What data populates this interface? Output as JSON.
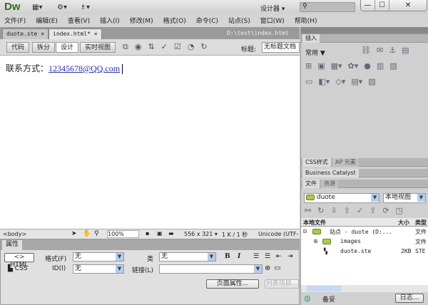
{
  "app": {
    "logo": "Dw",
    "designer": "设计器 ▾",
    "search_placeholder": "",
    "window_buttons": [
      "—",
      "☐",
      "✕"
    ]
  },
  "menu": [
    "文件(F)",
    "编辑(E)",
    "查看(V)",
    "插入(I)",
    "修改(M)",
    "格式(O)",
    "命令(C)",
    "站点(S)",
    "窗口(W)",
    "帮助(H)"
  ],
  "doc_tabs": [
    {
      "label": "duote.ste",
      "close": "×"
    },
    {
      "label": "index.html*",
      "close": "×"
    }
  ],
  "doc_path": "D:\\test\\index.html",
  "toolbar": {
    "views": [
      "代码",
      "拆分",
      "设计",
      "实时视图"
    ],
    "active_view": "设计",
    "title_label": "标题:",
    "title_value": "无标题文档"
  },
  "content": {
    "label": "联系方式：",
    "email": "12345678@QQ.com"
  },
  "status": {
    "tag": "<body>",
    "zoom": "100%",
    "size": "556 x 321 ▾",
    "download": "1 K / 1 秒",
    "encoding": "Unicode (UTF-"
  },
  "properties": {
    "tab": "属性",
    "html_btn": "HTML",
    "css_btn": "CSS",
    "format_label": "格式(F)",
    "format_value": "无",
    "class_label": "类",
    "class_value": "无",
    "id_label": "ID(I)",
    "id_value": "无",
    "link_label": "链接(L)",
    "link_value": "",
    "bold": "B",
    "italic": "I",
    "page_props": "页面属性...",
    "list_item": "列表项目..."
  },
  "right_panel": {
    "insert_tab": "插入",
    "category": "常用",
    "css_tab": "CSS样式",
    "ap_tab": "AP 元素",
    "bc_tab": "Business Catalyst",
    "files_tab": "文件",
    "assets_tab": "资源",
    "site_select": "duote",
    "view_select": "本地视图",
    "columns": [
      "本地文件",
      "大小",
      "类型"
    ],
    "files": [
      {
        "name": "站点 - duote (D:...",
        "size": "",
        "type": "文件"
      },
      {
        "name": "images",
        "size": "",
        "type": "文件"
      },
      {
        "name": "duote.ste",
        "size": "2KB",
        "type": "STE"
      }
    ],
    "footer_label": "备妥",
    "log_button": "日志..."
  }
}
